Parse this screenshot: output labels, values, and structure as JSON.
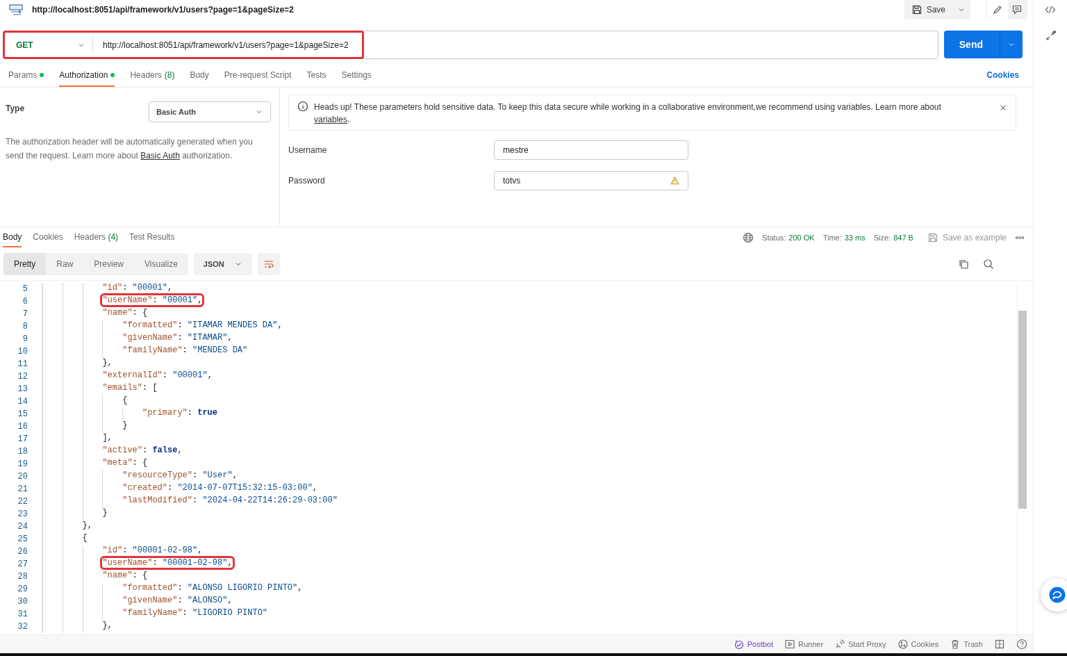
{
  "request": {
    "title": "http://localhost:8051/api/framework/v1/users?page=1&pageSize=2",
    "save": "Save",
    "method": "GET",
    "url": "http://localhost:8051/api/framework/v1/users?page=1&pageSize=2",
    "send": "Send"
  },
  "request_tabs": [
    {
      "label": "Params",
      "dot": true,
      "selected": false
    },
    {
      "label": "Authorization",
      "dot": true,
      "selected": true
    },
    {
      "label": "Headers",
      "count": "(8)",
      "dot": false,
      "selected": false
    },
    {
      "label": "Body",
      "dot": false,
      "selected": false
    },
    {
      "label": "Pre-request Script",
      "dot": false,
      "selected": false
    },
    {
      "label": "Tests",
      "dot": false,
      "selected": false
    },
    {
      "label": "Settings",
      "dot": false,
      "selected": false
    }
  ],
  "cookies_link": "Cookies",
  "auth": {
    "type_label": "Type",
    "type_value": "Basic Auth",
    "description": "The authorization header will be automatically generated when you send the request. Learn more about ",
    "description_link": "Basic Auth",
    "description_end": " authorization.",
    "notice": "Heads up! These parameters hold sensitive data. To keep this data secure while working in a collaborative environment,we recommend using variables. Learn more about ",
    "notice_link": "variables",
    "notice_end": ".",
    "fields": [
      {
        "label": "Username",
        "value": "mestre",
        "warning": false
      },
      {
        "label": "Password",
        "value": "totvs",
        "warning": true
      }
    ]
  },
  "response": {
    "tabs": [
      {
        "label": "Body",
        "selected": true
      },
      {
        "label": "Cookies",
        "selected": false
      },
      {
        "label": "Headers",
        "count": "(4)",
        "selected": false
      },
      {
        "label": "Test Results",
        "selected": false
      }
    ],
    "status_label": "Status:",
    "status": "200 OK",
    "time_label": "Time:",
    "time": "33 ms",
    "size_label": "Size:",
    "size": "847 B",
    "save_example": "Save as example",
    "views": [
      {
        "label": "Pretty",
        "selected": true
      },
      {
        "label": "Raw",
        "selected": false
      },
      {
        "label": "Preview",
        "selected": false
      },
      {
        "label": "Visualize",
        "selected": false
      }
    ],
    "format": "JSON"
  },
  "code_lines": [
    {
      "number": "5",
      "text": "            \"id\": \"00001\",",
      "highlighted": false
    },
    {
      "number": "6",
      "text": "            \"userName\": \"00001\",",
      "highlighted": true
    },
    {
      "number": "7",
      "text": "            \"name\": {",
      "highlighted": false
    },
    {
      "number": "8",
      "text": "                \"formatted\": \"ITAMAR MENDES DA\",",
      "highlighted": false
    },
    {
      "number": "9",
      "text": "                \"givenName\": \"ITAMAR\",",
      "highlighted": false
    },
    {
      "number": "10",
      "text": "                \"familyName\": \"MENDES DA\"",
      "highlighted": false
    },
    {
      "number": "11",
      "text": "            },",
      "highlighted": false
    },
    {
      "number": "12",
      "text": "            \"externalId\": \"00001\",",
      "highlighted": false
    },
    {
      "number": "13",
      "text": "            \"emails\": [",
      "highlighted": false
    },
    {
      "number": "14",
      "text": "                {",
      "highlighted": false
    },
    {
      "number": "15",
      "text": "                    \"primary\": true",
      "highlighted": false
    },
    {
      "number": "16",
      "text": "                }",
      "highlighted": false
    },
    {
      "number": "17",
      "text": "            ],",
      "highlighted": false
    },
    {
      "number": "18",
      "text": "            \"active\": false,",
      "highlighted": false
    },
    {
      "number": "19",
      "text": "            \"meta\": {",
      "highlighted": false
    },
    {
      "number": "20",
      "text": "                \"resourceType\": \"User\",",
      "highlighted": false
    },
    {
      "number": "21",
      "text": "                \"created\": \"2014-07-07T15:32:15-03:00\",",
      "highlighted": false
    },
    {
      "number": "22",
      "text": "                \"lastModified\": \"2024-04-22T14:26:29-03:00\"",
      "highlighted": false
    },
    {
      "number": "23",
      "text": "            }",
      "highlighted": false
    },
    {
      "number": "24",
      "text": "        },",
      "highlighted": false
    },
    {
      "number": "25",
      "text": "        {",
      "highlighted": false
    },
    {
      "number": "26",
      "text": "            \"id\": \"00001-02-98\",",
      "highlighted": false
    },
    {
      "number": "27",
      "text": "            \"userName\": \"00001-02-98\",",
      "highlighted": true
    },
    {
      "number": "28",
      "text": "            \"name\": {",
      "highlighted": false
    },
    {
      "number": "29",
      "text": "                \"formatted\": \"ALONSO LIGORIO PINTO\",",
      "highlighted": false
    },
    {
      "number": "30",
      "text": "                \"givenName\": \"ALONSO\",",
      "highlighted": false
    },
    {
      "number": "31",
      "text": "                \"familyName\": \"LIGORIO PINTO\"",
      "highlighted": false
    },
    {
      "number": "32",
      "text": "            },",
      "highlighted": false
    }
  ],
  "status_bar": [
    {
      "label": "Postbot",
      "kind": "postbot"
    },
    {
      "label": "Runner",
      "kind": "runner"
    },
    {
      "label": "Start Proxy",
      "kind": "proxy"
    },
    {
      "label": "Cookies",
      "kind": "cookies"
    },
    {
      "label": "Trash",
      "kind": "trash"
    }
  ]
}
